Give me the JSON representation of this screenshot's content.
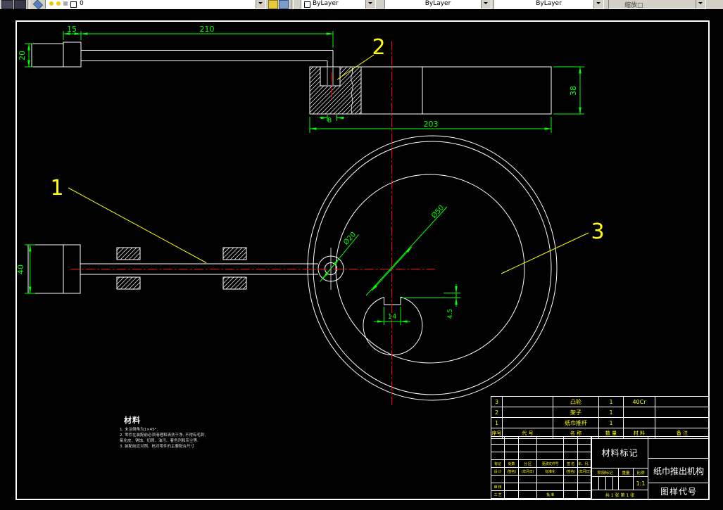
{
  "toolbar": {
    "layer_value": "0",
    "color_value": "ByLayer",
    "linetype_value": "ByLayer",
    "lineweight_value": "ByLayer",
    "plotstyle_value": "缩放□"
  },
  "drawing": {
    "part_labels": {
      "p1": "1",
      "p2": "2",
      "p3": "3"
    },
    "dims": {
      "w15": "15",
      "w210": "210",
      "h20": "20",
      "w8": "8",
      "w203": "203",
      "h38": "38",
      "dia20": "Ø20",
      "dia50": "Ø50",
      "w14": "14",
      "h45": "4.5",
      "h40": "40"
    },
    "notes": {
      "heading": "材料",
      "line1": "1. 未注倒角为1×45°.",
      "line2": "2. 零件在装配前必须清理和清洗干净, 不得有毛刺,",
      "line3": "氧化皮、锈蚀、切屑、油污、着色剂和灰尘等.",
      "line4": "3. 装配前应对照、核对零件的主要配合尺寸"
    }
  },
  "bom": {
    "headers": [
      "序号",
      "代  号",
      "名  称",
      "数 量",
      "材  料",
      "备  注"
    ],
    "rows": [
      {
        "no": "3",
        "code": "",
        "name": "凸轮",
        "qty": "1",
        "material": "40Cr",
        "remark": ""
      },
      {
        "no": "2",
        "code": "",
        "name": "架子",
        "qty": "1",
        "material": "",
        "remark": ""
      },
      {
        "no": "1",
        "code": "",
        "name": "纸巾推杆",
        "qty": "1",
        "material": "",
        "remark": ""
      }
    ]
  },
  "title_block": {
    "material_mark": "材料标记",
    "product_name": "纸巾推出机构",
    "drawing_code": "图样代号",
    "stage_header": "阶段标记",
    "weight_header": "重量",
    "scale_header": "比例",
    "scale_value": "1:1",
    "sheet_info": "共 1 张  第 1 张",
    "sig": {
      "row_change": [
        "标记",
        "处数",
        "分 区",
        "更改文件号",
        "签 名",
        "年、月、日"
      ],
      "row_design": [
        "设 计",
        "(签名)",
        "(年月日)",
        "标准化",
        "(签名)",
        "(年月日)"
      ],
      "row_check": "审 核",
      "row_process": "工 艺",
      "row_approve": "批 准"
    }
  }
}
